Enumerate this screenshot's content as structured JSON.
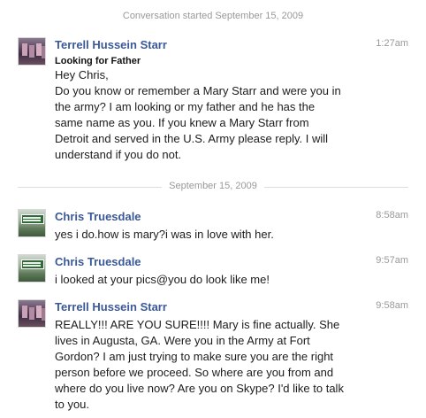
{
  "conversation": {
    "started_label": "Conversation started September 15, 2009"
  },
  "divider": {
    "date_label": "September 15, 2009"
  },
  "messages": [
    {
      "sender": "Terrell Hussein Starr",
      "time": "1:27am",
      "subject": "Looking for Father",
      "lines": [
        "Hey Chris,",
        "Do you know or remember a Mary Starr and were you in",
        "the army? I am looking or my father and he has the",
        "same name as you. If you knew a Mary Starr from",
        "Detroit and served in the U.S. Army please reply. I will",
        "understand if you do not."
      ],
      "avatar_icon": "profile-photo-icon"
    },
    {
      "sender": "Chris Truesdale",
      "time": "8:58am",
      "lines": [
        "yes i do.how is mary?i was in love with her."
      ],
      "avatar_icon": "profile-photo-icon"
    },
    {
      "sender": "Chris Truesdale",
      "time": "9:57am",
      "lines": [
        "i looked at your pics@you do look like me!"
      ],
      "avatar_icon": "profile-photo-icon"
    },
    {
      "sender": "Terrell Hussein Starr",
      "time": "9:58am",
      "lines": [
        "REALLY!!! ARE YOU SURE!!!! Mary is fine actually. She",
        "lives in Augusta, GA. Were you in the Army at Fort",
        "Gordon? I am just trying to make sure you are the right",
        "person before we proceed. So where are you from and",
        "where do you live now? Are you on Skype? I'd like to talk",
        "to you."
      ],
      "avatar_icon": "profile-photo-icon"
    }
  ],
  "colors": {
    "link": "#3b5998",
    "muted": "#999999",
    "text": "#1c1c1c"
  }
}
